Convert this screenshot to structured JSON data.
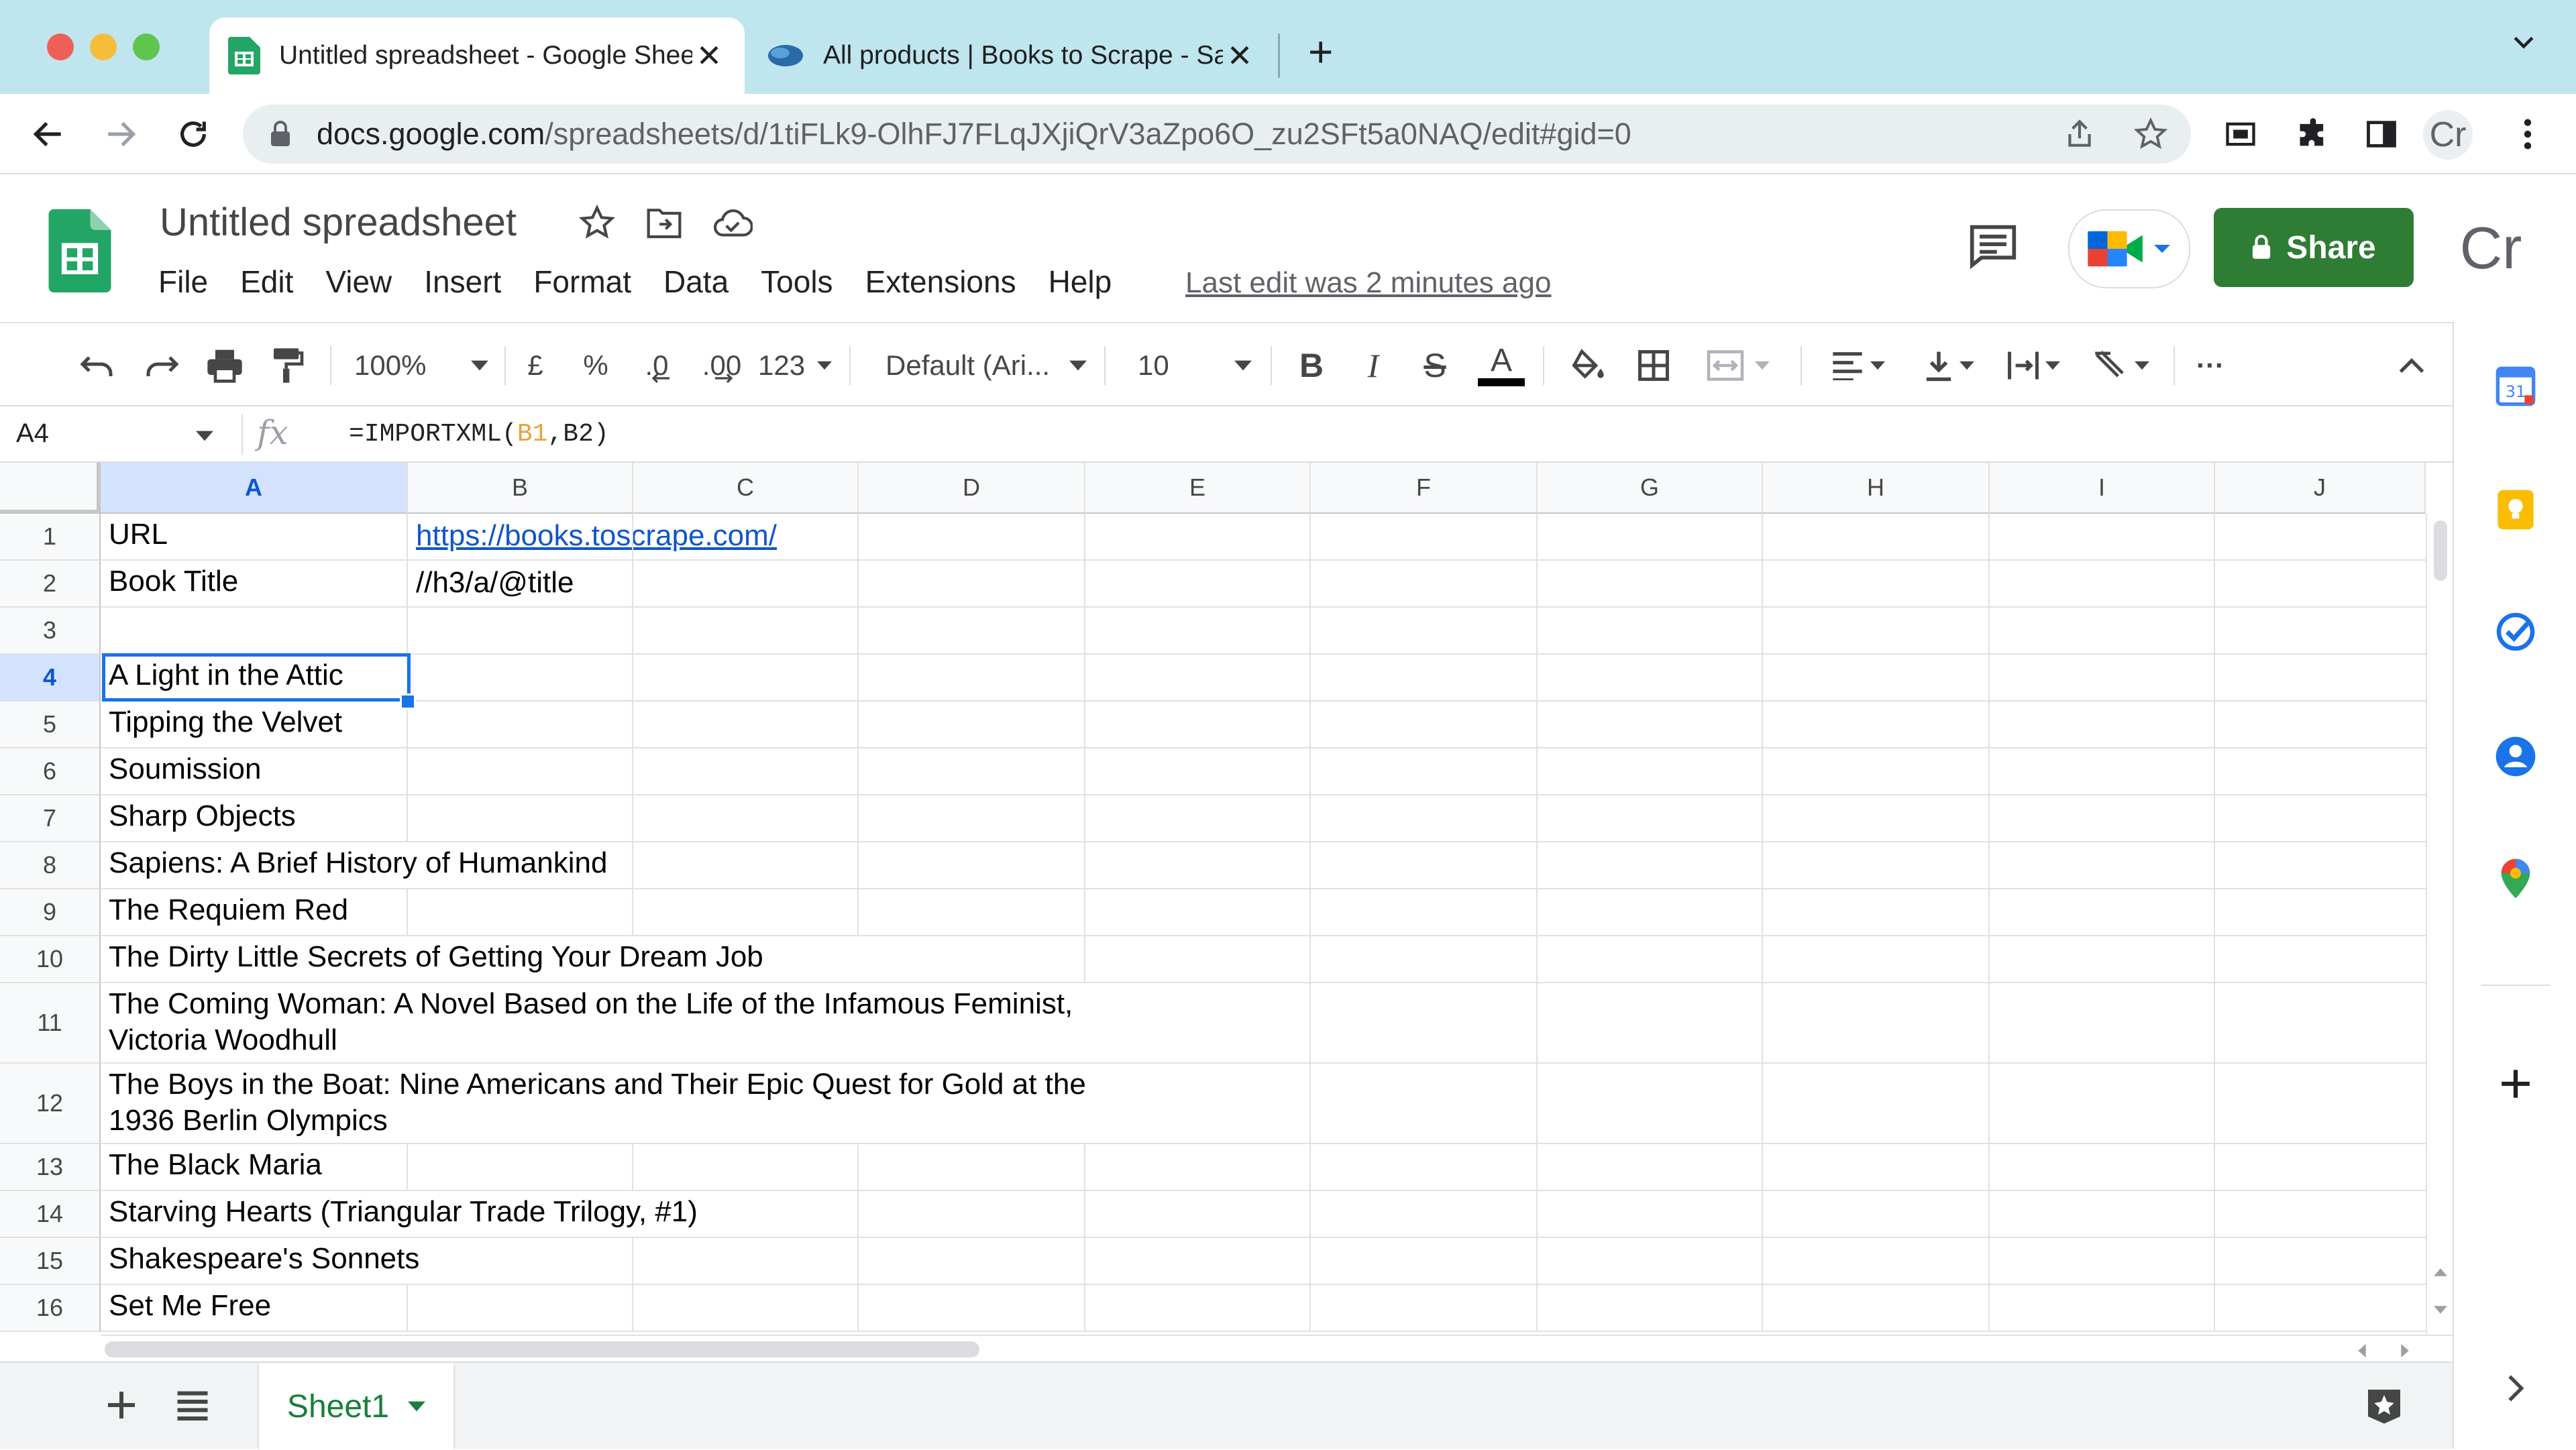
{
  "browser": {
    "tabs": [
      {
        "title": "Untitled spreadsheet - Google Sheets",
        "active": true
      },
      {
        "title": "All products | Books to Scrape - Sandbox",
        "active": false
      }
    ],
    "url_host": "docs.google.com",
    "url_path": "/spreadsheets/d/1tiFLk9-OlhFJ7FLqJXjiQrV3aZpo6O_zu2SFt5a0NAQ/edit#gid=0",
    "profile_initials": "Cr"
  },
  "app": {
    "doc_title": "Untitled spreadsheet",
    "menu": [
      "File",
      "Edit",
      "View",
      "Insert",
      "Format",
      "Data",
      "Tools",
      "Extensions",
      "Help"
    ],
    "last_edit": "Last edit was 2 minutes ago",
    "share_label": "Share",
    "avatar_initials": "Cr"
  },
  "format_toolbar": {
    "zoom": "100%",
    "currency": "£",
    "percent": "%",
    "dec_decrease": ".0",
    "dec_increase": ".00",
    "number_format": "123",
    "font": "Default (Ari...",
    "font_size": "10",
    "more": "···"
  },
  "formula_bar": {
    "name_box": "A4",
    "fx": "fx",
    "formula_prefix": "=IMPORTXML(",
    "ref1": "B1",
    "comma": ",",
    "ref2": "B2",
    "formula_suffix": ")"
  },
  "grid": {
    "columns": [
      "A",
      "B",
      "C",
      "D",
      "E",
      "F",
      "G",
      "H",
      "I",
      "J"
    ],
    "selected_column": "A",
    "rows": [
      {
        "num": "1",
        "a": "URL",
        "b": "https://books.toscrape.com/"
      },
      {
        "num": "2",
        "a": "Book Title",
        "b": "//h3/a/@title"
      },
      {
        "num": "3",
        "a": "",
        "b": ""
      },
      {
        "num": "4",
        "a": "A Light in the Attic",
        "b": ""
      },
      {
        "num": "5",
        "a": "Tipping the Velvet",
        "b": ""
      },
      {
        "num": "6",
        "a": "Soumission",
        "b": ""
      },
      {
        "num": "7",
        "a": "Sharp Objects",
        "b": ""
      },
      {
        "num": "8",
        "a": "Sapiens: A Brief History of Humankind",
        "b": ""
      },
      {
        "num": "9",
        "a": "The Requiem Red",
        "b": ""
      },
      {
        "num": "10",
        "a": "The Dirty Little Secrets of Getting Your Dream Job",
        "b": ""
      },
      {
        "num": "11",
        "a": "The Coming Woman: A Novel Based on the Life of the Infamous Feminist,",
        "a2": "Victoria Woodhull",
        "b": ""
      },
      {
        "num": "12",
        "a": "The Boys in the Boat: Nine Americans and Their Epic Quest for Gold at the",
        "a2": "1936 Berlin Olympics",
        "b": ""
      },
      {
        "num": "13",
        "a": "The Black Maria",
        "b": ""
      },
      {
        "num": "14",
        "a": "Starving Hearts (Triangular Trade Trilogy, #1)",
        "b": ""
      },
      {
        "num": "15",
        "a": "Shakespeare's Sonnets",
        "b": ""
      },
      {
        "num": "16",
        "a": "Set Me Free",
        "b": ""
      }
    ]
  },
  "sheets": {
    "active": "Sheet1"
  },
  "side_panel": {
    "calendar_day": "31"
  },
  "colors": {
    "share_green": "#2f7c34",
    "selection_blue": "#1a73e8",
    "tabstrip": "#bfe5ef",
    "ref1_color": "#e8a33d",
    "link_blue": "#1155cc"
  }
}
